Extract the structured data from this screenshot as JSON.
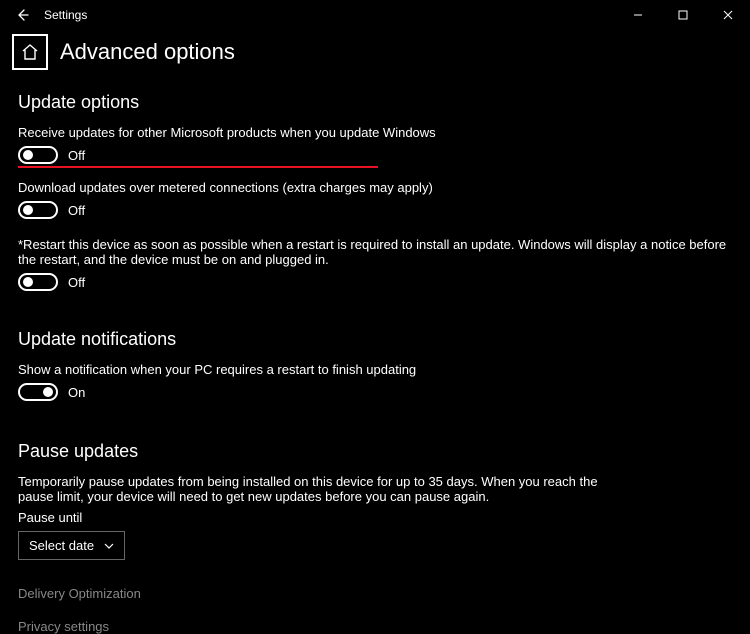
{
  "window": {
    "app_title": "Settings"
  },
  "header": {
    "page_title": "Advanced options"
  },
  "sections": {
    "update_options": {
      "title": "Update options",
      "items": [
        {
          "label": "Receive updates for other Microsoft products when you update Windows",
          "state": "Off"
        },
        {
          "label": "Download updates over metered connections (extra charges may apply)",
          "state": "Off"
        },
        {
          "label": "*Restart this device as soon as possible when a restart is required to install an update. Windows will display a notice before the restart, and the device must be on and plugged in.",
          "state": "Off"
        }
      ]
    },
    "update_notifications": {
      "title": "Update notifications",
      "items": [
        {
          "label": "Show a notification when your PC requires a restart to finish updating",
          "state": "On"
        }
      ]
    },
    "pause_updates": {
      "title": "Pause updates",
      "desc": "Temporarily pause updates from being installed on this device for up to 35 days. When you reach the pause limit, your device will need to get new updates before you can pause again.",
      "pause_label": "Pause until",
      "select_value": "Select date"
    }
  },
  "links": {
    "delivery": "Delivery Optimization",
    "privacy": "Privacy settings"
  }
}
